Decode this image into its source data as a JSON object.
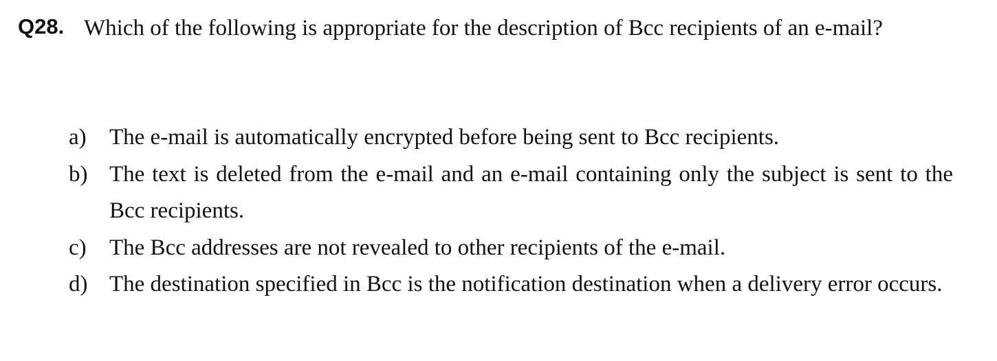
{
  "question": {
    "number": "Q28.",
    "text": "Which of the following is appropriate for the description of Bcc recipients of an e-mail?"
  },
  "options": [
    {
      "label": "a)",
      "text": "The e-mail is automatically encrypted before being sent to Bcc recipients."
    },
    {
      "label": "b)",
      "text": "The text is deleted from the e-mail and an e-mail containing only the subject is sent to the Bcc recipients."
    },
    {
      "label": "c)",
      "text": "The Bcc addresses are not revealed to other recipients of the e-mail."
    },
    {
      "label": "d)",
      "text": "The destination specified in Bcc is the notification destination when a delivery error occurs."
    }
  ]
}
